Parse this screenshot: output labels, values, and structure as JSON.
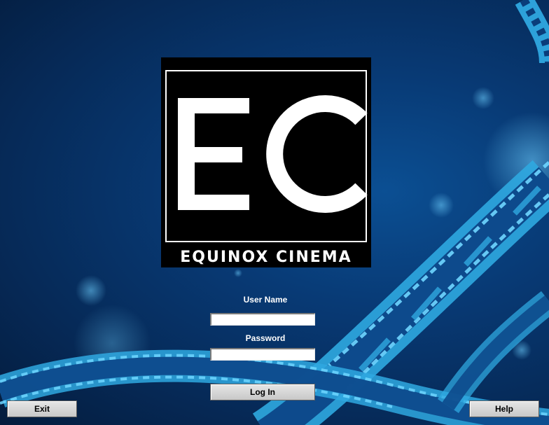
{
  "logo": {
    "monogram": "EC",
    "name": "EQUINOX CINEMA"
  },
  "login": {
    "username_label": "User Name",
    "username_value": "",
    "password_label": "Password",
    "password_value": "",
    "login_button": "Log In"
  },
  "footer": {
    "exit_button": "Exit",
    "help_button": "Help"
  },
  "colors": {
    "background": "#083a75",
    "filmstrip": "#2fa8e0",
    "logo_bg": "#000000",
    "text": "#ffffff"
  }
}
